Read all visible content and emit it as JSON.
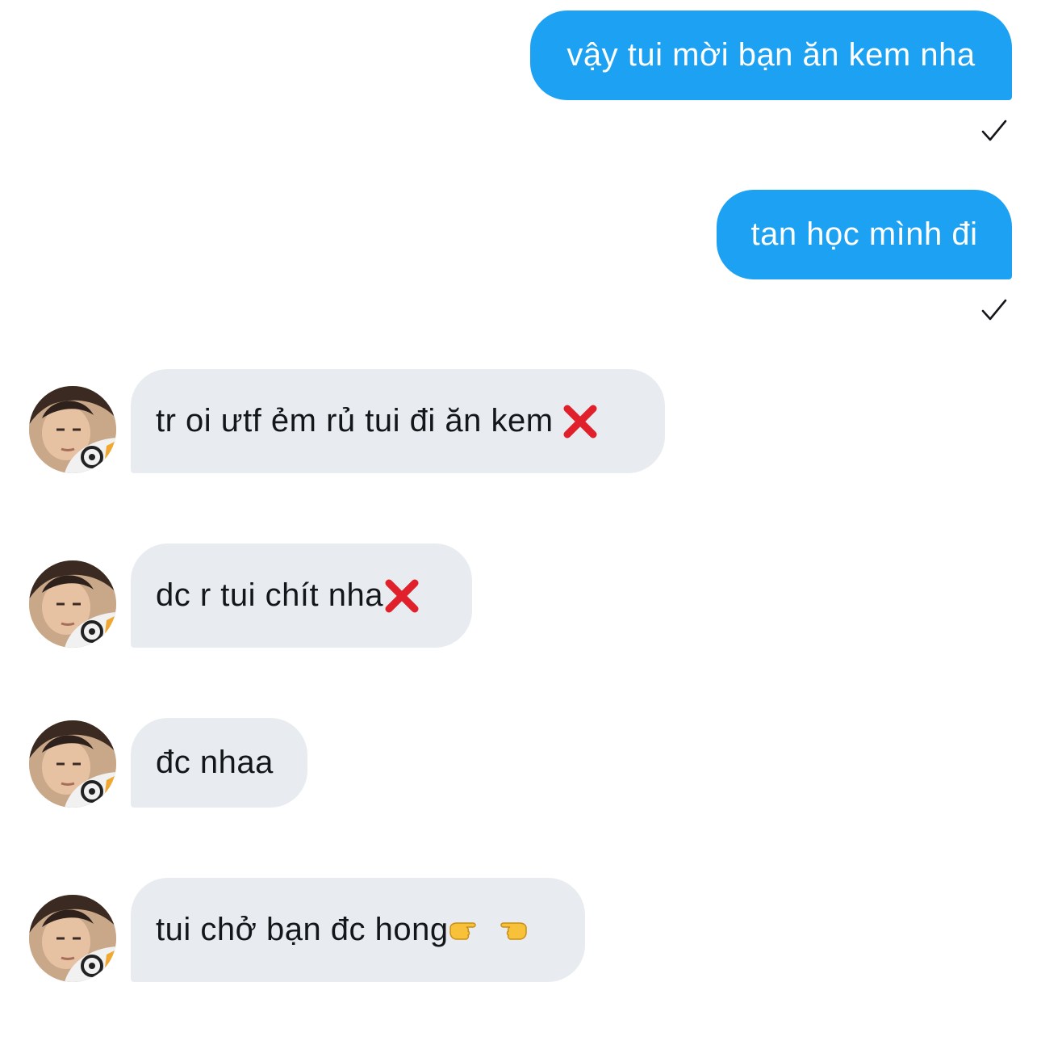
{
  "messages": [
    {
      "direction": "outgoing",
      "text": "vậy tui mời bạn ăn kem nha",
      "status_icon": "checkmark-icon"
    },
    {
      "direction": "outgoing",
      "text": "tan học mình đi",
      "status_icon": "checkmark-icon"
    },
    {
      "direction": "incoming",
      "text": "tr oi ưtf ẻm rủ tui đi ăn kem",
      "emoji": [
        "cross-mark-emoji"
      ]
    },
    {
      "direction": "incoming",
      "text": "dc r tui chít nha",
      "emoji": [
        "cross-mark-emoji"
      ]
    },
    {
      "direction": "incoming",
      "text": "đc nhaa",
      "emoji": []
    },
    {
      "direction": "incoming",
      "text": "tui chở bạn đc hong",
      "emoji": [
        "pointing-right-emoji",
        "pointing-left-emoji"
      ]
    }
  ],
  "colors": {
    "outgoing_bubble": "#1da1f2",
    "incoming_bubble": "#e8ecf0",
    "incoming_text": "#14171a",
    "outgoing_text": "#ffffff",
    "cross_mark": "#e0202a"
  }
}
